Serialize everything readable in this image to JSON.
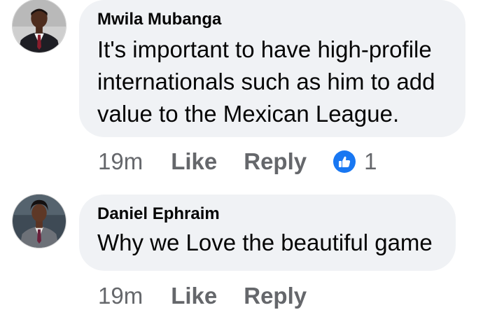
{
  "comments": [
    {
      "author": "Mwila Mubanga",
      "text": "It's important to have high-profile\ninternationals such as him to add\nvalue to the Mexican League.",
      "time": "19m",
      "like_label": "Like",
      "reply_label": "Reply",
      "reaction_count": "1",
      "reaction_icon": "like-thumb-icon"
    },
    {
      "author": "Daniel Ephraim",
      "text": "Why we Love the beautiful game",
      "time": "19m",
      "like_label": "Like",
      "reply_label": "Reply"
    }
  ],
  "colors": {
    "bubble": "#f0f2f5",
    "meta_text": "#65676b",
    "like_blue": "#1877f2"
  }
}
